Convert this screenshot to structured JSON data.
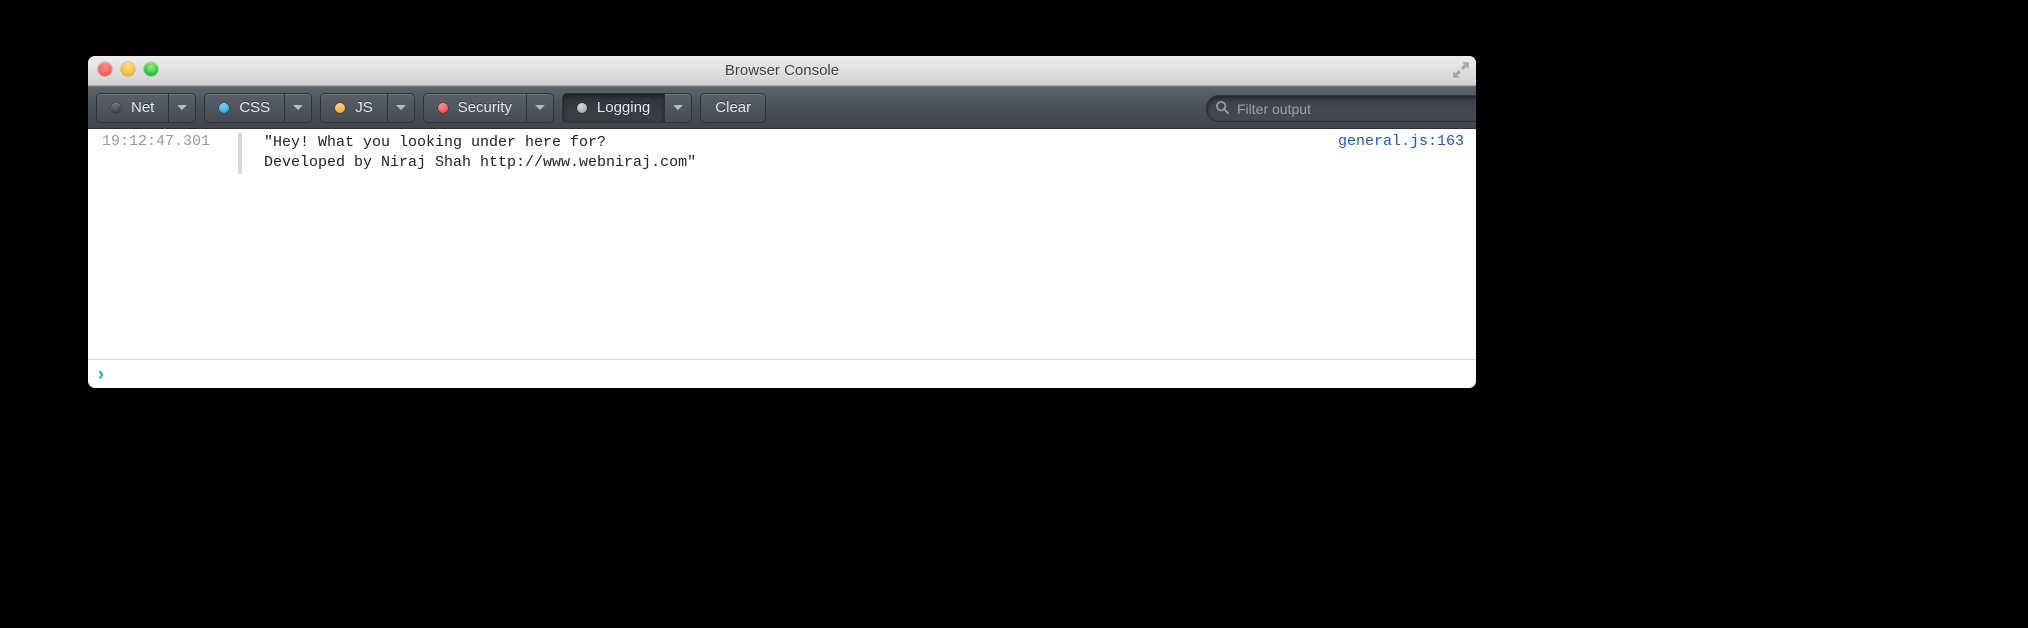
{
  "window": {
    "title": "Browser Console"
  },
  "toolbar": {
    "filters": [
      {
        "label": "Net",
        "dot": "dark"
      },
      {
        "label": "CSS",
        "dot": "blue"
      },
      {
        "label": "JS",
        "dot": "orange"
      },
      {
        "label": "Security",
        "dot": "red"
      },
      {
        "label": "Logging",
        "dot": "grey",
        "active": true
      }
    ],
    "clear_label": "Clear",
    "filter_placeholder": "Filter output"
  },
  "log": {
    "entries": [
      {
        "timestamp": "19:12:47.301",
        "message": "\"Hey! What you looking under here for?\nDeveloped by Niraj Shah http://www.webniraj.com\"",
        "source": "general.js:163"
      }
    ]
  },
  "input": {
    "value": ""
  }
}
